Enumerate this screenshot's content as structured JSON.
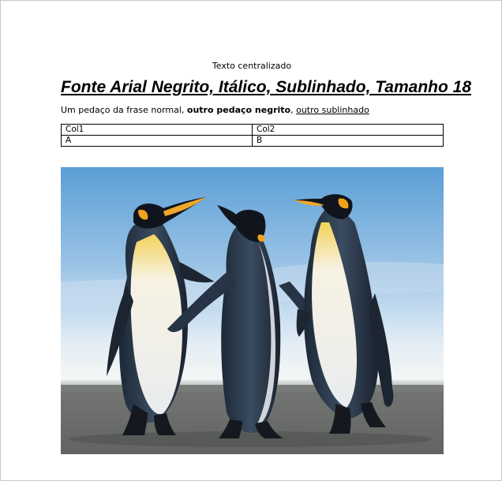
{
  "document": {
    "centered_text": "Texto centralizado",
    "title": "Fonte Arial Negrito, Itálico, Sublinhado, Tamanho 18",
    "paragraph": {
      "normal": "Um pedaço da frase normal, ",
      "bold": "outro pedaço negrito",
      "separator": ", ",
      "underline": "outro sublinhado"
    },
    "table": {
      "headers": [
        "Col1",
        "Col2"
      ],
      "rows": [
        [
          "A",
          "B"
        ]
      ]
    },
    "image": {
      "subject": "three emperor penguins on a beach"
    }
  }
}
